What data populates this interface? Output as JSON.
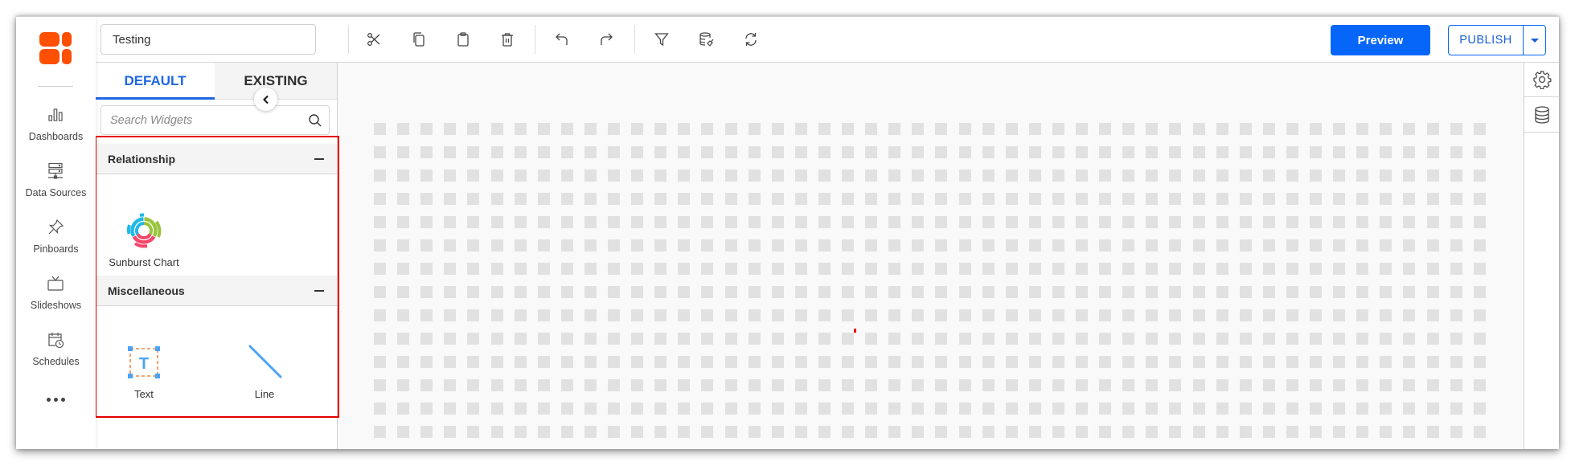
{
  "brand": {
    "logo_icon": "boldbi-logo-icon",
    "accent": "#ff4f00"
  },
  "nav": {
    "items": [
      {
        "id": "dashboards",
        "label": "Dashboards",
        "icon": "bar-chart-icon"
      },
      {
        "id": "data-sources",
        "label": "Data Sources",
        "icon": "server-icon"
      },
      {
        "id": "pinboards",
        "label": "Pinboards",
        "icon": "pushpin-icon"
      },
      {
        "id": "slideshows",
        "label": "Slideshows",
        "icon": "tv-icon"
      },
      {
        "id": "schedules",
        "label": "Schedules",
        "icon": "calendar-clock-icon"
      }
    ],
    "more_icon": "more-horizontal-icon"
  },
  "toolbar": {
    "title_value": "Testing",
    "actions": [
      {
        "id": "cut",
        "icon": "scissors-icon"
      },
      {
        "id": "copy",
        "icon": "copy-icon"
      },
      {
        "id": "paste",
        "icon": "clipboard-icon"
      },
      {
        "id": "delete",
        "icon": "trash-icon"
      },
      {
        "id": "undo",
        "icon": "undo-icon"
      },
      {
        "id": "redo",
        "icon": "redo-icon"
      },
      {
        "id": "filter",
        "icon": "filter-icon"
      },
      {
        "id": "clear-cache",
        "icon": "database-brush-icon"
      },
      {
        "id": "refresh",
        "icon": "refresh-icon"
      }
    ],
    "preview_label": "Preview",
    "publish_label": "PUBLISH",
    "primary_color": "#0666fa"
  },
  "panel": {
    "tabs": [
      {
        "label": "DEFAULT",
        "active": true
      },
      {
        "label": "EXISTING",
        "active": false
      }
    ],
    "search_placeholder": "Search Widgets",
    "groups": [
      {
        "name": "Relationship",
        "toggle": "collapse",
        "widgets": [
          {
            "label": "Sunburst Chart",
            "icon": "sunburst-chart-icon"
          }
        ]
      },
      {
        "name": "Miscellaneous",
        "toggle": "collapse",
        "widgets": [
          {
            "label": "Text",
            "icon": "text-widget-icon"
          },
          {
            "label": "Line",
            "icon": "line-widget-icon"
          }
        ]
      }
    ],
    "highlight_color": "#e60000"
  },
  "canvas": {
    "grid_columns": 48,
    "grid_rows": 15
  },
  "right_panel": {
    "buttons": [
      {
        "id": "settings",
        "icon": "gear-icon"
      },
      {
        "id": "data",
        "icon": "database-icon"
      }
    ]
  }
}
